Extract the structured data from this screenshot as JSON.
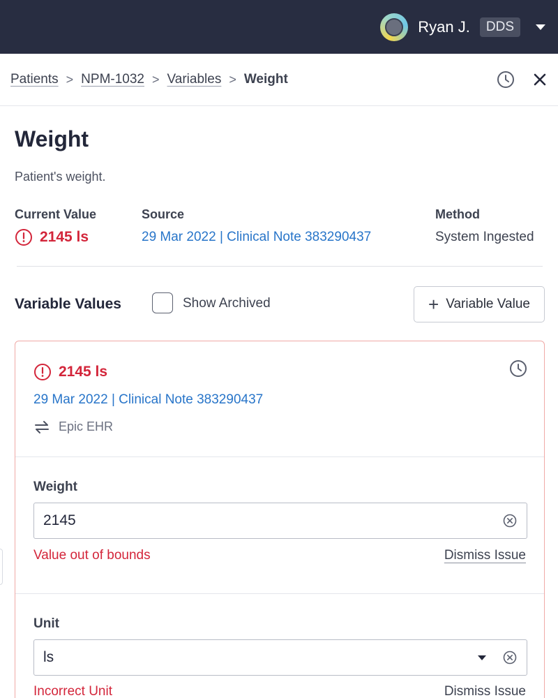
{
  "header": {
    "user_name": "Ryan J.",
    "user_badge": "DDS"
  },
  "breadcrumb": {
    "items": [
      "Patients",
      "NPM-1032",
      "Variables"
    ],
    "separator": ">",
    "current": "Weight"
  },
  "variable": {
    "title": "Weight",
    "description": "Patient's weight.",
    "current_value_label": "Current Value",
    "current_value": "2145 ls",
    "source_label": "Source",
    "source": "29 Mar 2022 | Clinical Note 383290437",
    "method_label": "Method",
    "method": "System Ingested"
  },
  "values_section": {
    "title": "Variable Values",
    "show_archived_label": "Show Archived",
    "show_archived": false,
    "add_button_label": "Variable Value"
  },
  "card": {
    "value": "2145 ls",
    "source": "29 Mar 2022 | Clinical Note 383290437",
    "origin": "Epic EHR",
    "weight_field": {
      "label": "Weight",
      "value": "2145",
      "error": "Value out of bounds",
      "dismiss_label": "Dismiss Issue"
    },
    "unit_field": {
      "label": "Unit",
      "value": "ls",
      "error": "Incorrect Unit",
      "dismiss_label": "Dismiss Issue"
    }
  },
  "colors": {
    "topbar": "#282d41",
    "error": "#d3253a",
    "link": "#2875c9",
    "card_border": "#f0a9a6"
  },
  "icons": [
    "avatar",
    "chevron-down-icon",
    "history-icon",
    "close-icon",
    "error-circle-icon",
    "sync-arrows-icon",
    "clear-circle-icon",
    "plus-icon"
  ]
}
